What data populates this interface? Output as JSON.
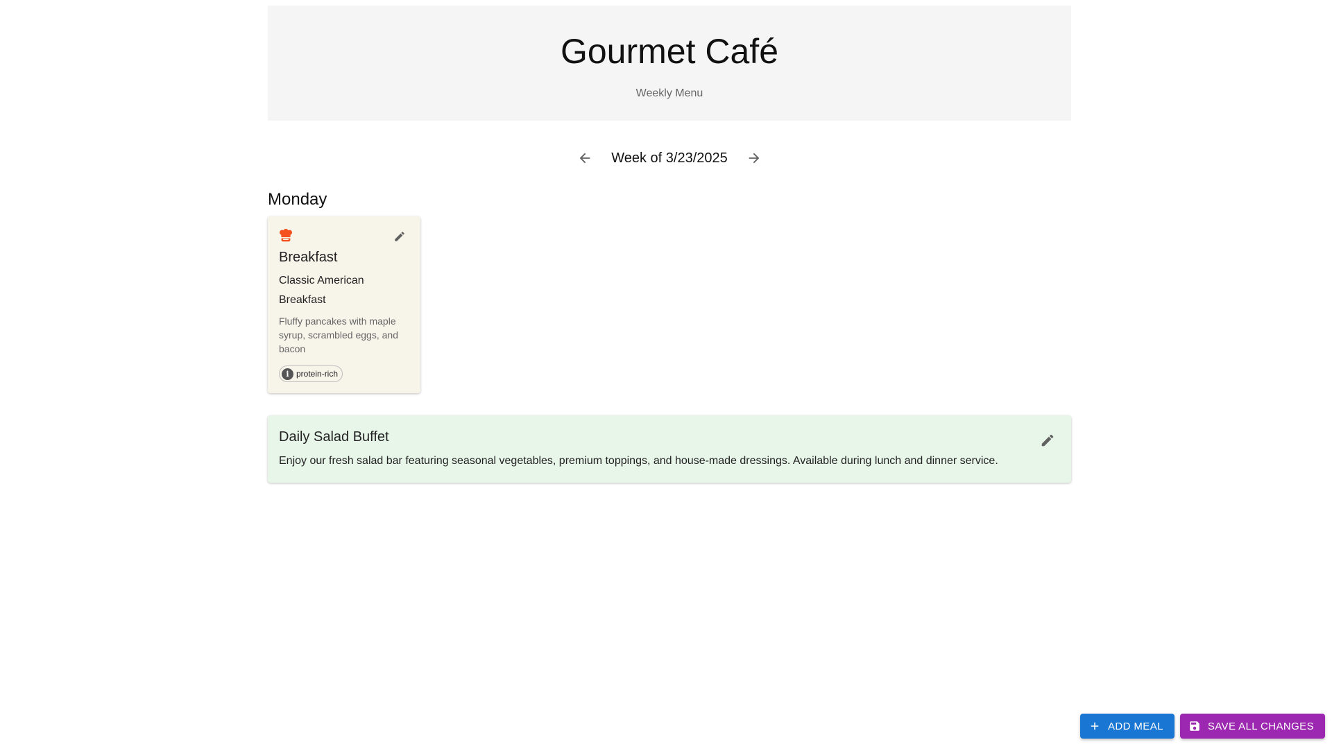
{
  "header": {
    "title": "Gourmet Café",
    "subtitle": "Weekly Menu"
  },
  "week_nav": {
    "label": "Week of 3/23/2025",
    "prev_icon": "arrow-left-icon",
    "next_icon": "arrow-right-icon"
  },
  "days": [
    {
      "name": "Monday",
      "meals": [
        {
          "icon": "chef-hat-icon",
          "type": "Breakfast",
          "name": "Classic American Breakfast",
          "description": "Fluffy pancakes with maple syrup, scrambled eggs, and bacon",
          "tags": [
            "protein-rich"
          ]
        }
      ]
    }
  ],
  "salad_buffet": {
    "title": "Daily Salad Buffet",
    "description": "Enjoy our fresh salad bar featuring seasonal vegetables, premium toppings, and house-made dressings. Available during lunch and dinner service."
  },
  "actions": {
    "add_meal": "ADD MEAL",
    "save_all": "SAVE ALL CHANGES"
  },
  "colors": {
    "header_bg": "#f5f5f5",
    "meal_card_bg": "#f7f4ea",
    "salad_bg": "#e8f5e9",
    "chef_icon": "#f4511e",
    "add_button": "#1976d2",
    "save_button": "#9c27b0"
  }
}
